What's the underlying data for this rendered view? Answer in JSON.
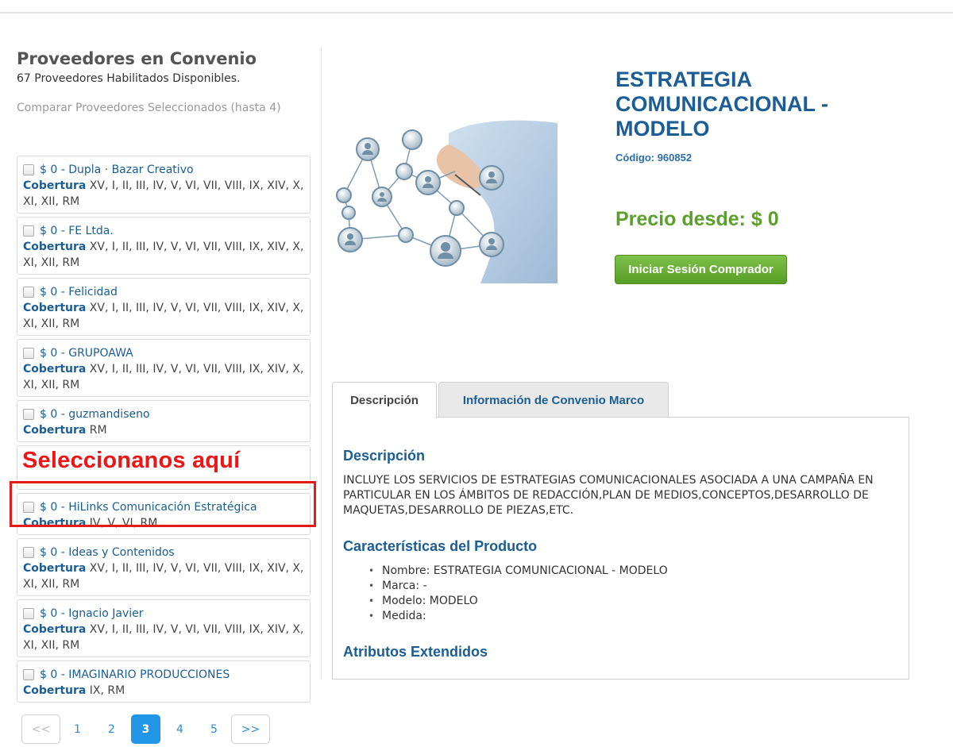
{
  "sidebar": {
    "title": "Proveedores en Convenio",
    "subtitle": "67 Proveedores Habilitados Disponibles.",
    "compare_link": "Comparar Proveedores Seleccionados (hasta 4)",
    "coverage_label": "Cobertura",
    "providers": [
      {
        "name": "$ 0 - Dupla · Bazar Creativo",
        "coverage": "XV, I, II, III, IV, V, VI, VII, VIII, IX, XIV, X, XI, XII, RM"
      },
      {
        "name": "$ 0 - FE Ltda.",
        "coverage": "XV, I, II, III, IV, V, VI, VII, VIII, IX, XIV, X, XI, XII, RM"
      },
      {
        "name": "$ 0 - Felicidad",
        "coverage": "XV, I, II, III, IV, V, VI, VII, VIII, IX, XIV, X, XI, XII, RM"
      },
      {
        "name": "$ 0 - GRUPOAWA",
        "coverage": "XV, I, II, III, IV, V, VI, VII, VIII, IX, XIV, X, XI, XII, RM"
      },
      {
        "name": "$ 0 - guzmandiseno",
        "coverage": "RM"
      },
      {
        "name": "$ 0 - HiLinks Comunicación Estratégica",
        "coverage": "IV, V, VI, RM"
      },
      {
        "name": "$ 0 - Ideas y Contenidos",
        "coverage": "XV, I, II, III, IV, V, VI, VII, VIII, IX, XIV, X, XI, XII, RM"
      },
      {
        "name": "$ 0 - Ignacio Javier",
        "coverage": "XV, I, II, III, IV, V, VI, VII, VIII, IX, XIV, X, XI, XII, RM"
      },
      {
        "name": "$ 0 - IMAGINARIO PRODUCCIONES",
        "coverage": "IX, RM"
      }
    ],
    "annotation": "Seleccionanos aquí"
  },
  "product": {
    "title": "ESTRATEGIA COMUNICACIONAL - MODELO",
    "code": "Código: 960852",
    "price": "Precio desde: $ 0",
    "login_button": "Iniciar Sesión Comprador"
  },
  "tabs": [
    {
      "label": "Descripción"
    },
    {
      "label": "Información de Convenio Marco"
    }
  ],
  "description": {
    "heading": "Descripción",
    "text": "INCLUYE LOS SERVICIOS DE ESTRATEGIAS COMUNICACIONALES ASOCIADA A UNA CAMPAÑA EN PARTICULAR EN LOS ÁMBITOS DE REDACCIÓN,PLAN DE MEDIOS,CONCEPTOS,DESARROLLO DE MAQUETAS,DESARROLLO DE PIEZAS,ETC.",
    "features_heading": "Características del Producto",
    "features": [
      "Nombre: ESTRATEGIA COMUNICACIONAL - MODELO",
      "Marca: -",
      "Modelo: MODELO",
      "Medida:"
    ],
    "extended_heading": "Atributos Extendidos"
  },
  "pagination": {
    "prev": "<<",
    "pages": [
      "1",
      "2",
      "3",
      "4",
      "5"
    ],
    "active": "3",
    "next": ">>"
  },
  "colors": {
    "link_blue": "#1b5d95",
    "price_green": "#5aa02a",
    "button_green": "#6bb23a",
    "annotation_red": "#e41b17",
    "pager_active": "#2196e6"
  }
}
